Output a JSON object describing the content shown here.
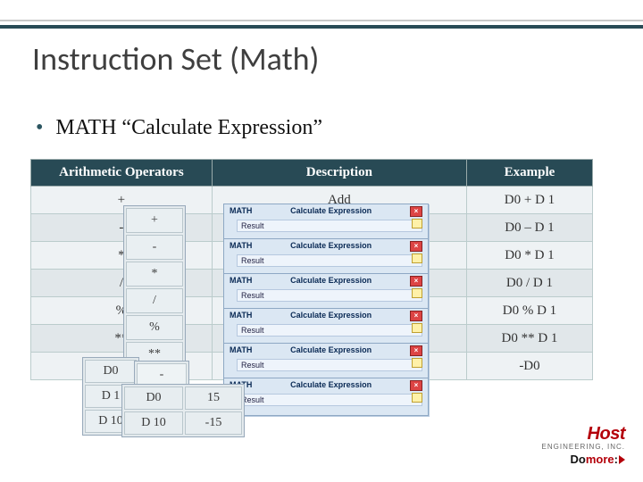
{
  "title": "Instruction Set (Math)",
  "bullet": "MATH “Calculate Expression”",
  "table": {
    "headers": {
      "op": "Arithmetic Operators",
      "desc": "Description",
      "ex": "Example"
    },
    "rows": [
      {
        "op": "+",
        "desc": "Add",
        "ex": "D0 + D 1"
      },
      {
        "op": "-",
        "desc": "",
        "ex": "D0 – D 1"
      },
      {
        "op": "*",
        "desc": "",
        "ex": "D0 * D 1"
      },
      {
        "op": "/",
        "desc": "",
        "ex": "D0 / D 1"
      },
      {
        "op": "%",
        "desc": "",
        "ex": "D0 % D 1"
      },
      {
        "op": "**",
        "desc": "",
        "ex": "D0 ** D 1"
      },
      {
        "op": "",
        "desc": "",
        "ex": "-D0"
      }
    ]
  },
  "frag_ops": [
    "+",
    "-",
    "*",
    "/",
    "%",
    "**"
  ],
  "frag_d_col": [
    "D0",
    "D 1",
    "D 10"
  ],
  "frag_neg": "-",
  "frag_data2": [
    [
      "D0",
      "15"
    ],
    [
      "D 10",
      "-15"
    ]
  ],
  "popup": {
    "title_left": "MATH",
    "title_right": "Calculate Expression",
    "line": "Result"
  },
  "logo": {
    "brand": "Host",
    "sub": "ENGINEERING, INC.",
    "tag_pre": "Do",
    "tag_em": "more",
    "tag_post": ":"
  }
}
